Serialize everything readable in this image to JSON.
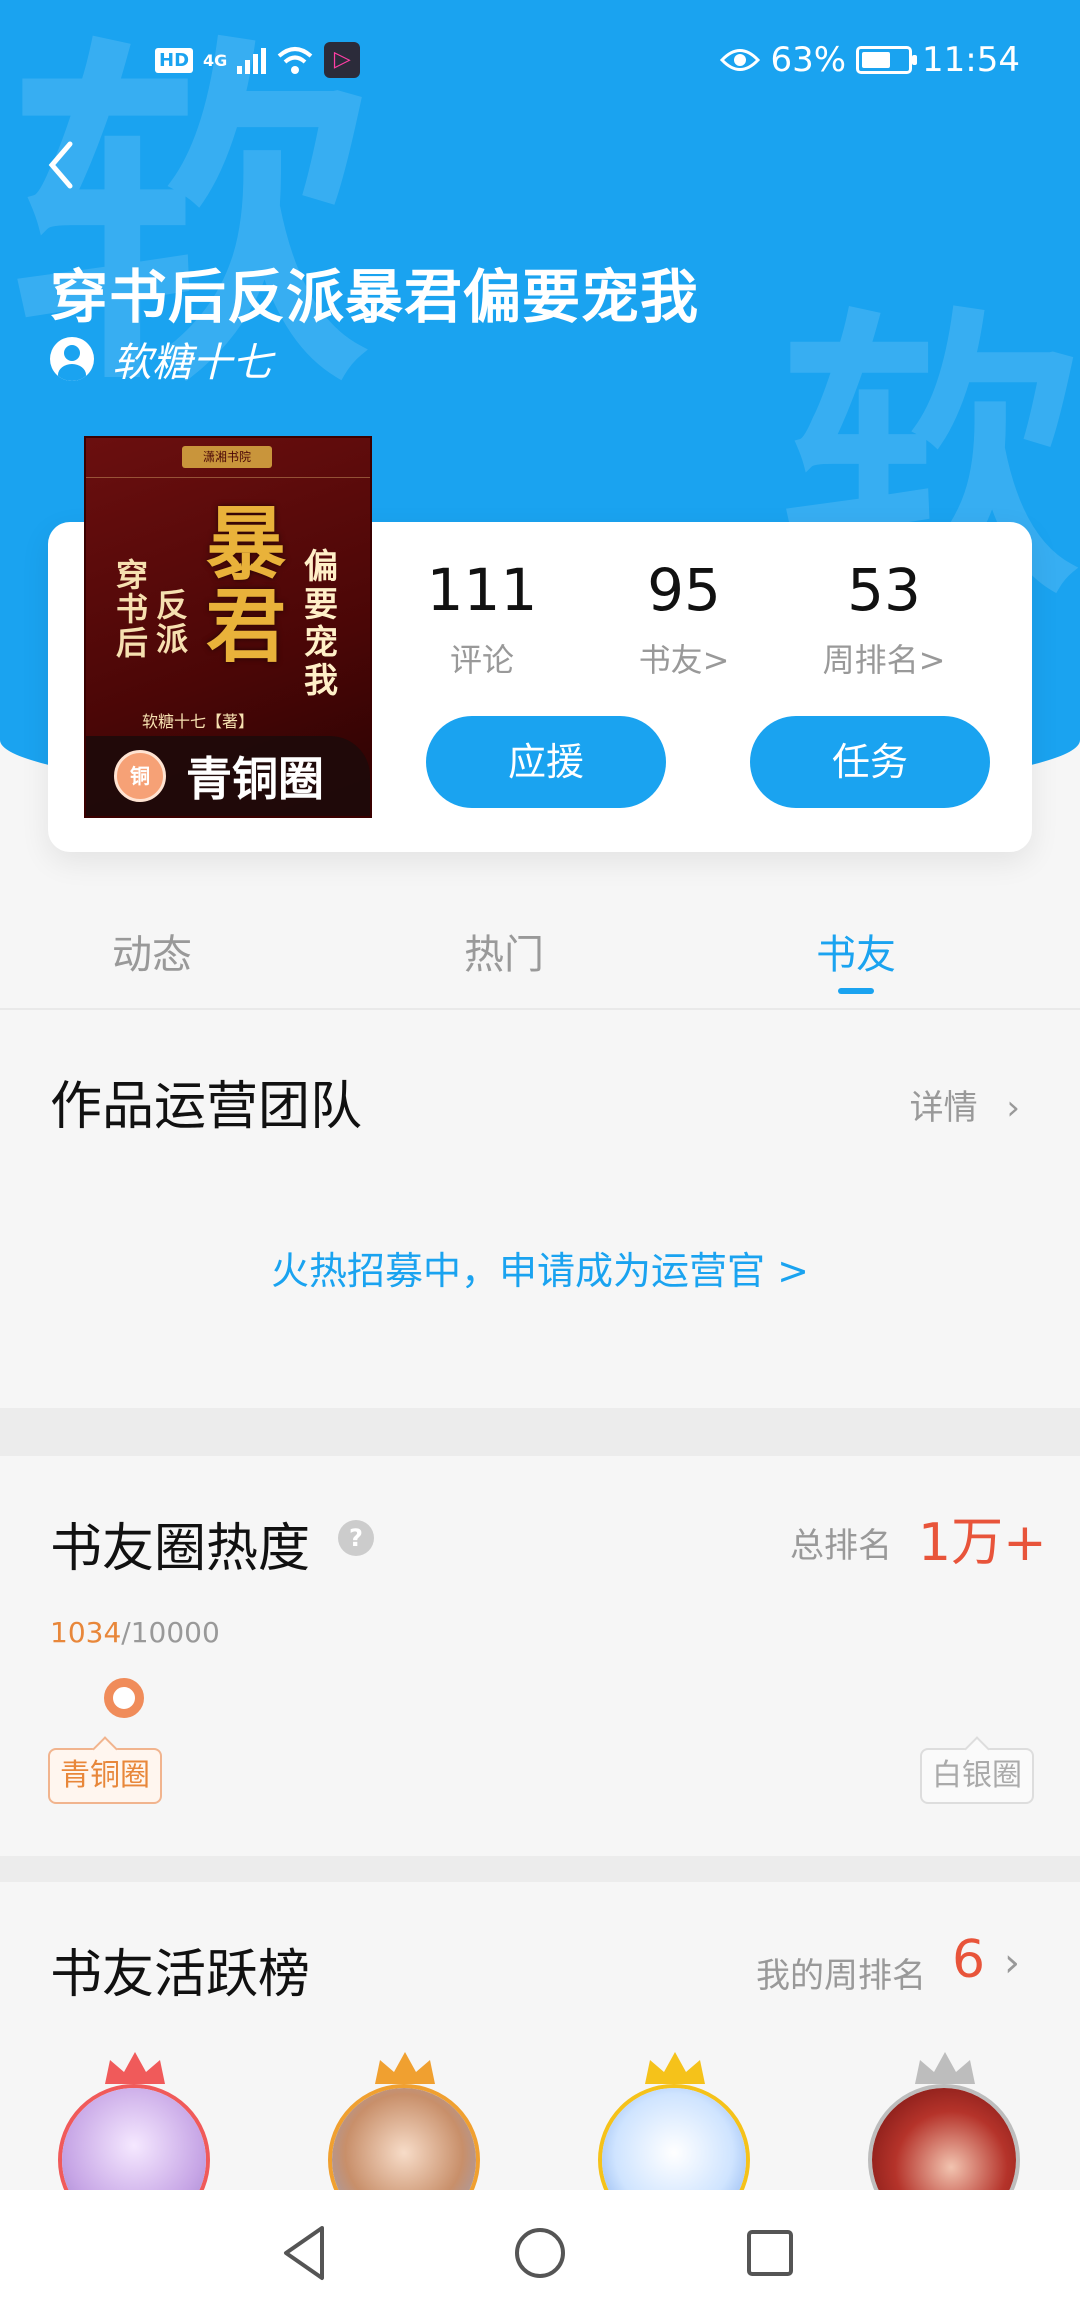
{
  "status_bar": {
    "hd": "HD",
    "network": "4G",
    "battery_percent": "63%",
    "battery_level": 0.63,
    "time": "11:54"
  },
  "hero": {
    "watermark_char": "软",
    "title": "穿书后反派暴君偏要宠我",
    "author": "软糖十七",
    "background_color": "#1aa3f0"
  },
  "book_cover": {
    "big_text": "暴君",
    "side_text": "偏要宠我",
    "small_text": "穿书后",
    "small_text2": "反派",
    "author_line": "软糖十七【著】",
    "seal": "潇湘书院",
    "badge_icon_char": "铜",
    "badge_label": "青铜圈"
  },
  "stats": [
    {
      "value": "111",
      "label": "评论"
    },
    {
      "value": "95",
      "label": "书友>"
    },
    {
      "value": "53",
      "label": "周排名>"
    }
  ],
  "buttons": {
    "support": "应援",
    "task": "任务"
  },
  "tabs": [
    {
      "label": "动态",
      "active": false
    },
    {
      "label": "热门",
      "active": false
    },
    {
      "label": "书友",
      "active": true
    }
  ],
  "operations_team": {
    "title": "作品运营团队",
    "detail_link": "详情",
    "recruit_text": "火热招募中，申请成为运营官 >"
  },
  "heat": {
    "title": "书友圈热度",
    "help_icon": "?",
    "total_rank_label": "总排名",
    "total_rank_value": "1万+",
    "progress_current": "1034",
    "progress_total": "/10000",
    "progress_fraction": 0.1034,
    "tier_current": "青铜圈",
    "tier_next": "白银圈"
  },
  "active_board": {
    "title": "书友活跃榜",
    "my_rank_label": "我的周排名",
    "my_rank_value": "6",
    "crown_colors": [
      "#f05a5a",
      "#f0a030",
      "#f5c21a",
      "#bdbdbd"
    ]
  },
  "accent_color": "#1aa3f0",
  "highlight_color": "#e8543a"
}
